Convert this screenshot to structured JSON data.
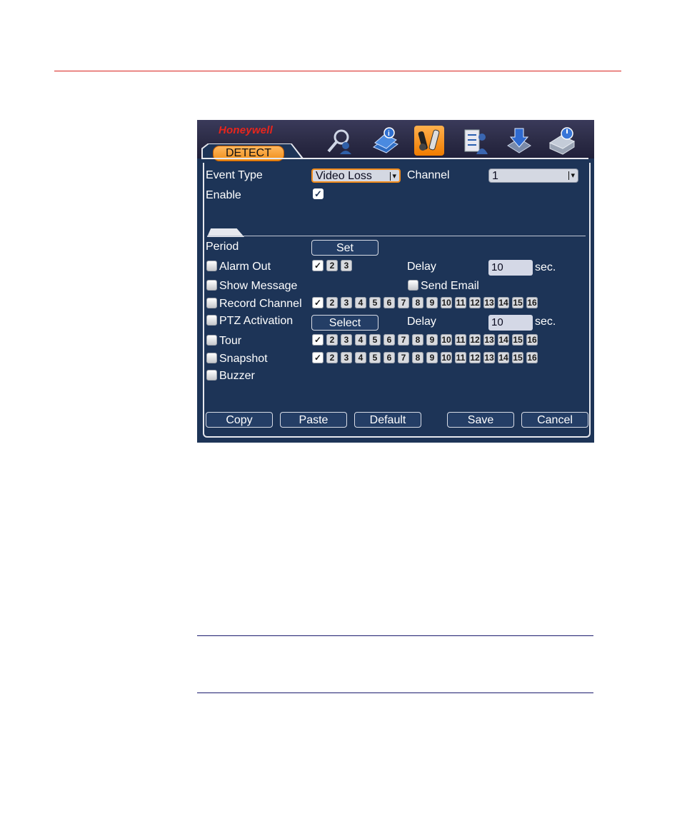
{
  "window": {
    "brand": "Honeywell",
    "active_tab": "DETECT",
    "toolbar_icons": [
      "search-user-icon",
      "book-info-icon",
      "tools-icon",
      "checklist-icon",
      "download-icon",
      "shutdown-icon"
    ],
    "active_icon_index": 2
  },
  "form": {
    "event_type_label": "Event Type",
    "event_type_value": "Video Loss",
    "channel_label": "Channel",
    "channel_value": "1",
    "enable_label": "Enable",
    "enable_checked": true,
    "period_label": "Period",
    "set_button": "Set",
    "alarm_out_label": "Alarm Out",
    "alarm_out_channels": [
      "1",
      "2",
      "3"
    ],
    "delay_label": "Delay",
    "delay_value": "10",
    "sec_label": "sec.",
    "show_message_label": "Show Message",
    "send_email_label": "Send Email",
    "record_channel_label": "Record Channel",
    "ptz_activation_label": "PTZ Activation",
    "select_button": "Select",
    "ptz_delay_label": "Delay",
    "ptz_delay_value": "10",
    "ptz_sec_label": "sec.",
    "tour_label": "Tour",
    "snapshot_label": "Snapshot",
    "buzzer_label": "Buzzer",
    "channels16": [
      "1",
      "2",
      "3",
      "4",
      "5",
      "6",
      "7",
      "8",
      "9",
      "10",
      "11",
      "12",
      "13",
      "14",
      "15",
      "16"
    ]
  },
  "buttons": {
    "copy": "Copy",
    "paste": "Paste",
    "default": "Default",
    "save": "Save",
    "cancel": "Cancel"
  },
  "colors": {
    "accent": "#f08a1a",
    "brand": "#e8251c",
    "panel_bg": "#1d3457"
  }
}
